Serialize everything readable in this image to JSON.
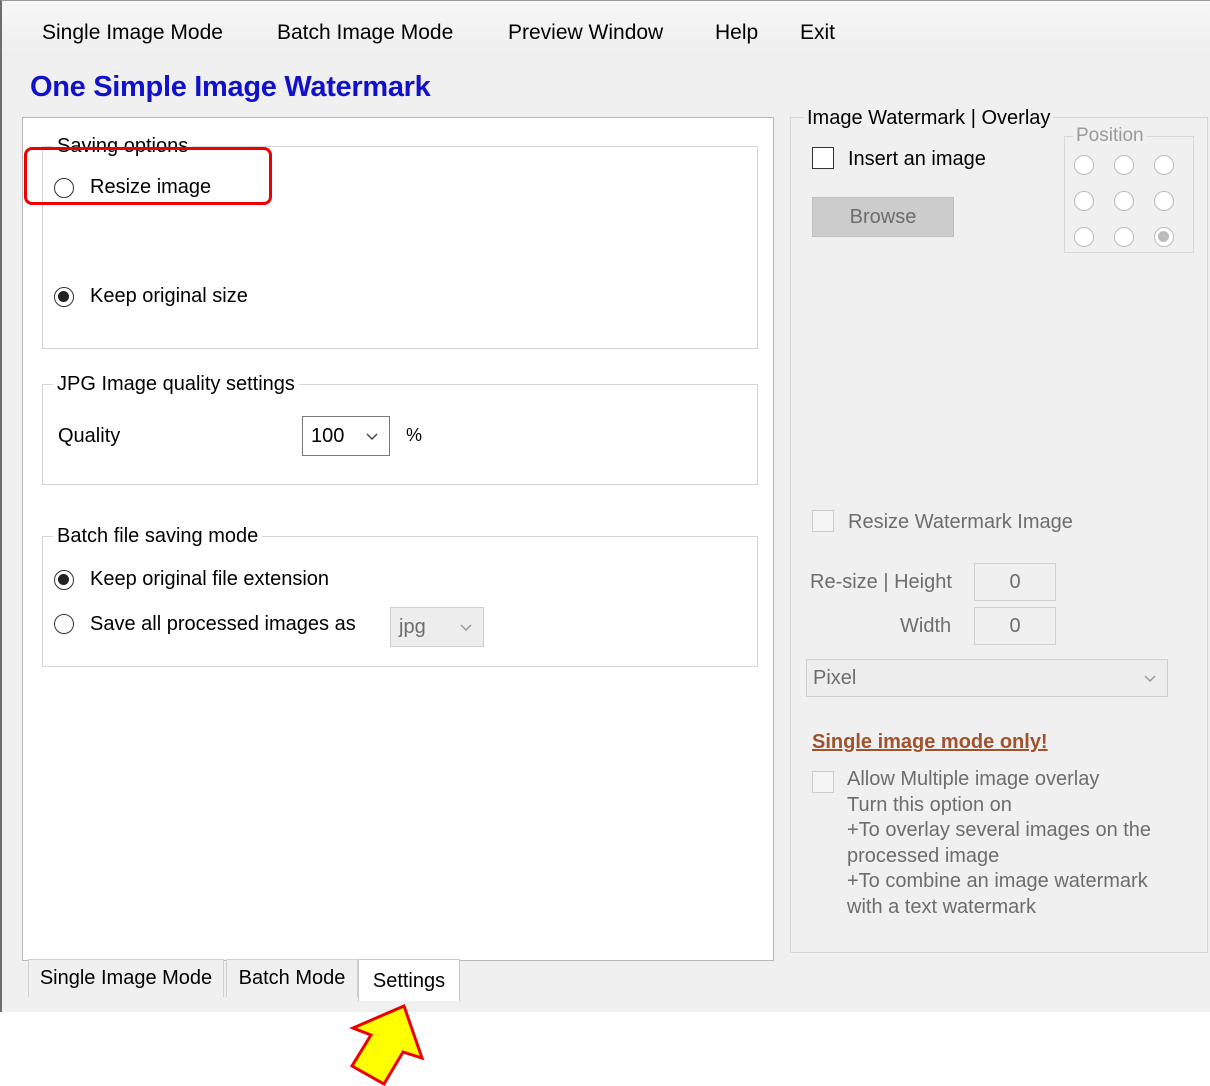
{
  "menu": {
    "items": [
      "Single Image Mode",
      "Batch Image Mode",
      "Preview Window",
      "Help",
      "Exit"
    ]
  },
  "app_title": "One Simple Image Watermark",
  "saving_options": {
    "legend": "Saving options",
    "resize_label": "Resize image",
    "keep_label": "Keep original size",
    "selected": "Keep original size"
  },
  "jpg_quality": {
    "legend": "JPG Image quality settings",
    "quality_label": "Quality",
    "quality_value": "100",
    "unit": "%"
  },
  "batch_saving": {
    "legend": "Batch file saving mode",
    "keep_ext_label": "Keep original file extension",
    "save_as_label": "Save all processed images as",
    "format_value": "jpg",
    "selected": "Keep original file extension"
  },
  "watermark_panel": {
    "legend": "Image Watermark | Overlay",
    "insert_label": "Insert an image",
    "browse_label": "Browse",
    "position_legend": "Position",
    "position_selected_index": 8,
    "resize_label": "Resize Watermark Image",
    "height_label": "Re-size | Height",
    "height_value": "0",
    "width_label": "Width",
    "width_value": "0",
    "unit_value": "Pixel",
    "single_only_label": "Single image mode only!",
    "allow_multiple_label": "Allow Multiple image overlay",
    "description": [
      "Turn this option on",
      "+To overlay several images on the",
      "processed image",
      "+To combine an image watermark",
      "with a text watermark"
    ]
  },
  "tabs": [
    "Single Image Mode",
    "Batch Mode",
    "Settings"
  ],
  "active_tab": "Settings",
  "colors": {
    "title": "#1111cc",
    "highlight": "#ee0000",
    "single_only": "#a0522d",
    "arrow_fill": "#ffff00"
  }
}
